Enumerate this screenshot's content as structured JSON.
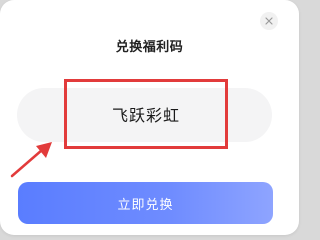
{
  "dialog": {
    "title": "兑换福利码",
    "close_icon": "close-icon"
  },
  "code_input": {
    "value": "飞跃彩虹"
  },
  "annotation": {
    "highlight_color": "#e23b3b",
    "arrow_icon": "arrow-icon"
  },
  "redeem_button": {
    "label": "立即兑换",
    "color": "#5a7dff"
  }
}
